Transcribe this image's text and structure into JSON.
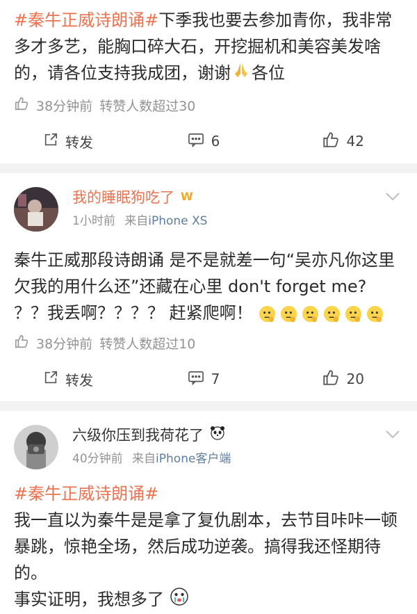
{
  "post1": {
    "tag": "#秦牛正威诗朗诵#",
    "text": "下季我也要去参加青你，我非常多才多艺，能胸口碎大石，开挖掘机和美容美发啥的，请各位支持我成团，谢谢",
    "tail": "各位",
    "meta_time": "38分钟前",
    "meta_repost": "转赞人数超过30",
    "repost_label": "转发",
    "comment_count": "6",
    "like_count": "42"
  },
  "post2": {
    "username": "我的睡眠狗吃了",
    "time": "1小时前",
    "source_prefix": "来自",
    "source": "iPhone XS",
    "text": "秦牛正威那段诗朗诵 是不是就差一句“吴亦凡你这里欠我的用什么还”还藏在心里 don't forget me? ？？我丢啊？？？？ 赶紧爬啊！",
    "meta_time": "38分钟前",
    "meta_repost": "转赞人数超过10",
    "repost_label": "转发",
    "comment_count": "7",
    "like_count": "20"
  },
  "post3": {
    "username": "六级你压到我荷花了",
    "time": "40分钟前",
    "source_prefix": "来自",
    "source": "iPhone客户端",
    "tag": "#秦牛正威诗朗诵#",
    "line1": "我一直以为秦牛是是拿了复仇剧本，去节目咔咔一顿暴跳，惊艳全场，然后成功逆袭。搞得我还怪期待的。",
    "line2": "事实证明，我想多了"
  },
  "colors": {
    "accent": "#eb7350",
    "link": "#5d7ea1",
    "meta": "#939393"
  },
  "icons": [
    "thumb-up-icon",
    "repost-icon",
    "comment-icon",
    "pray-hands-icon",
    "weibo-badge-icon",
    "chevron-down-icon",
    "thinking-emoji-icon",
    "panda-icon",
    "crying-face-emoji-icon"
  ]
}
